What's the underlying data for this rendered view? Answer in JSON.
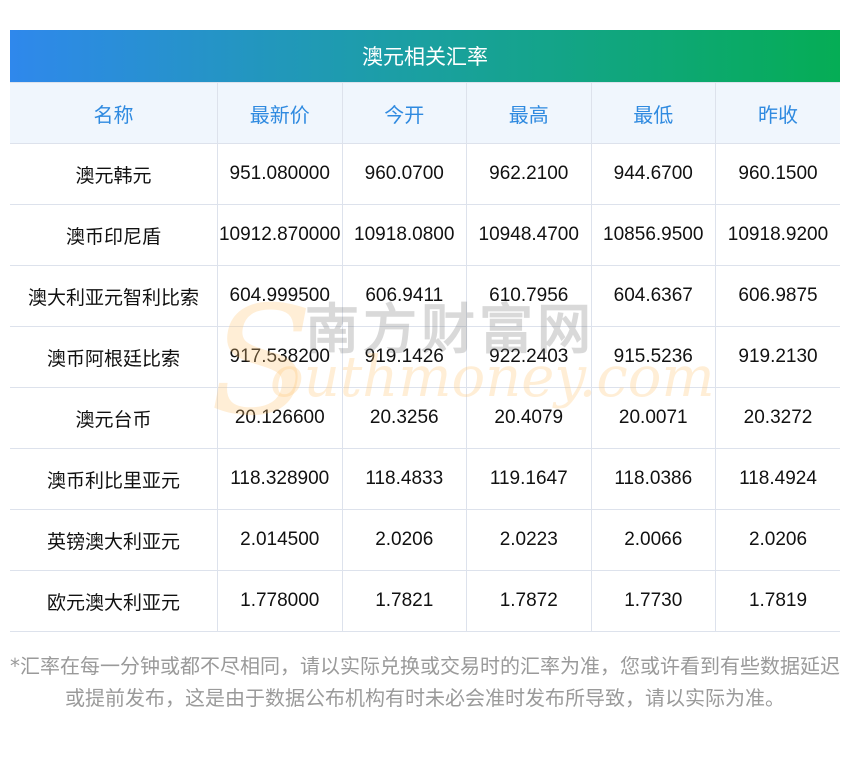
{
  "title": "澳元相关汇率",
  "headers": [
    "名称",
    "最新价",
    "今开",
    "最高",
    "最低",
    "昨收"
  ],
  "rows": [
    [
      "澳元韩元",
      "951.080000",
      "960.0700",
      "962.2100",
      "944.6700",
      "960.1500"
    ],
    [
      "澳币印尼盾",
      "10912.870000",
      "10918.0800",
      "10948.4700",
      "10856.9500",
      "10918.9200"
    ],
    [
      "澳大利亚元智利比索",
      "604.999500",
      "606.9411",
      "610.7956",
      "604.6367",
      "606.9875"
    ],
    [
      "澳币阿根廷比索",
      "917.538200",
      "919.1426",
      "922.2403",
      "915.5236",
      "919.2130"
    ],
    [
      "澳元台币",
      "20.126600",
      "20.3256",
      "20.4079",
      "20.0071",
      "20.3272"
    ],
    [
      "澳币利比里亚元",
      "118.328900",
      "118.4833",
      "119.1647",
      "118.0386",
      "118.4924"
    ],
    [
      "英镑澳大利亚元",
      "2.014500",
      "2.0206",
      "2.0223",
      "2.0066",
      "2.0206"
    ],
    [
      "欧元澳大利亚元",
      "1.778000",
      "1.7821",
      "1.7872",
      "1.7730",
      "1.7819"
    ]
  ],
  "watermark": {
    "cn": "南方财富网",
    "en": "outhmoney.com",
    "s": "S"
  },
  "note": "*汇率在每一分钟或都不尽相同，请以实际兑换或交易时的汇率为准，您或许看到有些数据延迟或提前发布，这是由于数据公布机构有时未必会准时发布所导致，请以实际为准。"
}
